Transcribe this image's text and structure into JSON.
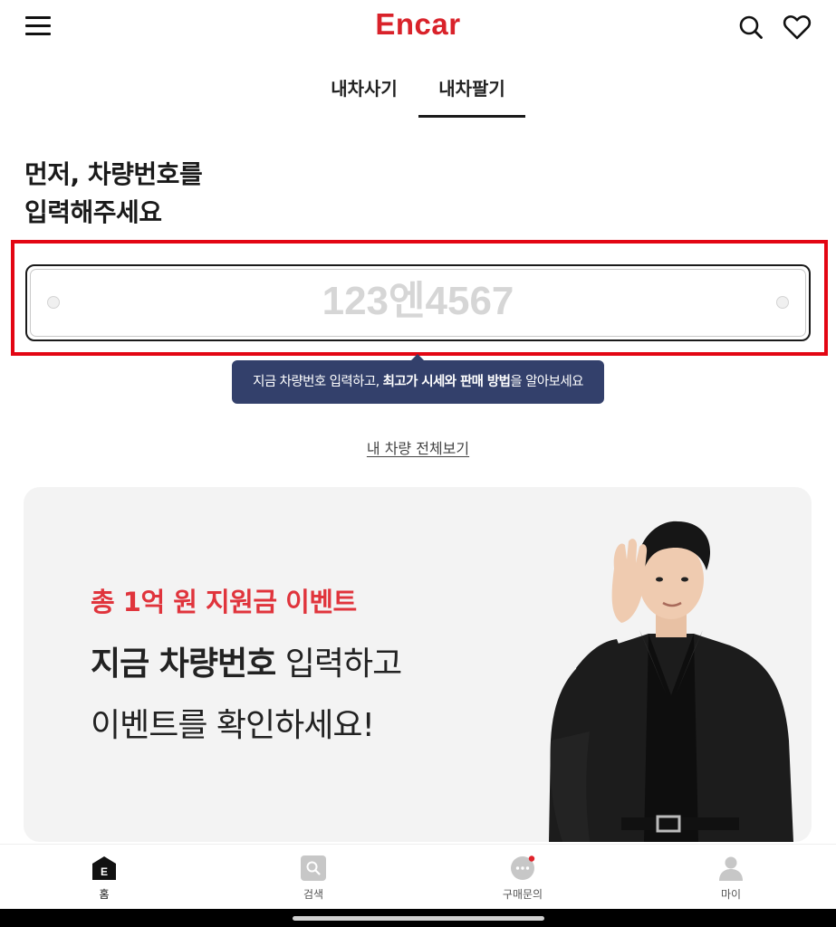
{
  "header": {
    "logo": "Encar"
  },
  "tabs": [
    {
      "label": "내차사기",
      "active": false
    },
    {
      "label": "내차팔기",
      "active": true
    }
  ],
  "heading": {
    "line1": "먼저, 차량번호를",
    "line2": "입력해주세요"
  },
  "plate_input": {
    "value": "",
    "placeholder": "123엔4567"
  },
  "tooltip": {
    "prefix": "지금 차량번호 입력하고, ",
    "bold": "최고가 시세와 판매 방법",
    "suffix": "을 알아보세요"
  },
  "all_cars_link": "내 차량 전체보기",
  "banner": {
    "event": "총 1억 원 지원금 이벤트",
    "line1_bold": "지금 차량번호",
    "line1_rest": " 입력하고",
    "line2": "이벤트를 확인하세요!"
  },
  "bottom_nav": [
    {
      "label": "홈",
      "icon": "home-e-icon",
      "active": true,
      "icon_letter": "E"
    },
    {
      "label": "검색",
      "icon": "search-icon",
      "active": false
    },
    {
      "label": "구매문의",
      "icon": "chat-icon",
      "active": false,
      "badge": true
    },
    {
      "label": "마이",
      "icon": "person-icon",
      "active": false
    }
  ],
  "colors": {
    "brand": "#d9222a",
    "tooltip_bg": "#33406b",
    "highlight": "#e30613",
    "event_text": "#e0343c"
  }
}
